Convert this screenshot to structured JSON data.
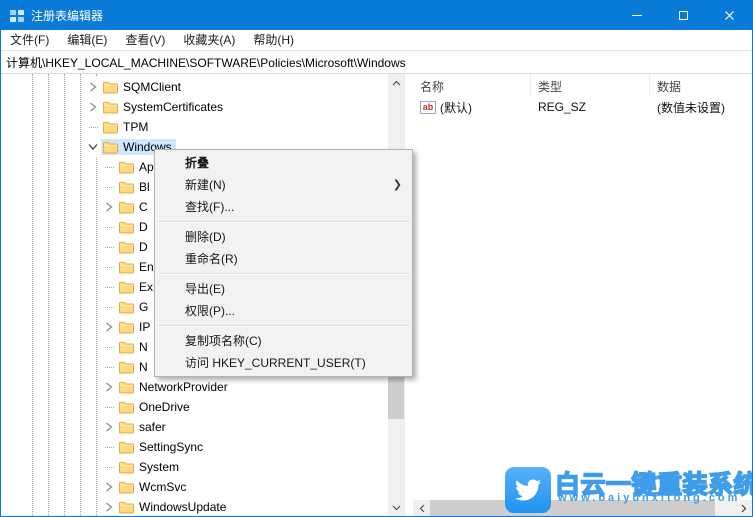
{
  "window": {
    "title": "注册表编辑器"
  },
  "icons": {
    "app": "registry-icon",
    "minimize": "minimize-icon",
    "maximize": "maximize-icon",
    "close": "close-icon",
    "string_value": "ab-string-value-icon",
    "watermark_logo": "twitter-bird-icon"
  },
  "menu_bar": {
    "items": [
      "文件(F)",
      "编辑(E)",
      "查看(V)",
      "收藏夹(A)",
      "帮助(H)"
    ]
  },
  "address_bar": {
    "value": "计算机\\HKEY_LOCAL_MACHINE\\SOFTWARE\\Policies\\Microsoft\\Windows"
  },
  "tree": {
    "items": [
      {
        "label": "SQMClient",
        "level": 0,
        "expander": "collapsed",
        "selected": false
      },
      {
        "label": "SystemCertificates",
        "level": 0,
        "expander": "collapsed",
        "selected": false
      },
      {
        "label": "TPM",
        "level": 0,
        "expander": "none",
        "selected": false
      },
      {
        "label": "Windows",
        "level": 0,
        "expander": "expanded",
        "selected": true
      },
      {
        "label": "Ap",
        "level": 1,
        "expander": "none",
        "selected": false
      },
      {
        "label": "Bl",
        "level": 1,
        "expander": "none",
        "selected": false
      },
      {
        "label": "C",
        "level": 1,
        "expander": "collapsed",
        "selected": false
      },
      {
        "label": "D",
        "level": 1,
        "expander": "none",
        "selected": false
      },
      {
        "label": "D",
        "level": 1,
        "expander": "none",
        "selected": false
      },
      {
        "label": "En",
        "level": 1,
        "expander": "none",
        "selected": false
      },
      {
        "label": "Ex",
        "level": 1,
        "expander": "none",
        "selected": false
      },
      {
        "label": "G",
        "level": 1,
        "expander": "none",
        "selected": false
      },
      {
        "label": "IP",
        "level": 1,
        "expander": "collapsed",
        "selected": false
      },
      {
        "label": "N",
        "level": 1,
        "expander": "none",
        "selected": false
      },
      {
        "label": "N",
        "level": 1,
        "expander": "none",
        "selected": false
      },
      {
        "label": "NetworkProvider",
        "level": 1,
        "expander": "collapsed",
        "selected": false
      },
      {
        "label": "OneDrive",
        "level": 1,
        "expander": "none",
        "selected": false
      },
      {
        "label": "safer",
        "level": 1,
        "expander": "collapsed",
        "selected": false
      },
      {
        "label": "SettingSync",
        "level": 1,
        "expander": "none",
        "selected": false
      },
      {
        "label": "System",
        "level": 1,
        "expander": "none",
        "selected": false
      },
      {
        "label": "WcmSvc",
        "level": 1,
        "expander": "collapsed",
        "selected": false
      },
      {
        "label": "WindowsUpdate",
        "level": 1,
        "expander": "collapsed",
        "selected": false
      }
    ]
  },
  "context_menu": {
    "items": [
      {
        "type": "item",
        "label": "折叠",
        "bold": true
      },
      {
        "type": "item",
        "label": "新建(N)",
        "submenu": true
      },
      {
        "type": "item",
        "label": "查找(F)..."
      },
      {
        "type": "separator"
      },
      {
        "type": "item",
        "label": "删除(D)"
      },
      {
        "type": "item",
        "label": "重命名(R)"
      },
      {
        "type": "separator"
      },
      {
        "type": "item",
        "label": "导出(E)"
      },
      {
        "type": "item",
        "label": "权限(P)..."
      },
      {
        "type": "separator"
      },
      {
        "type": "item",
        "label": "复制项名称(C)"
      },
      {
        "type": "item",
        "label": "访问 HKEY_CURRENT_USER(T)"
      }
    ]
  },
  "list": {
    "columns": [
      "名称",
      "类型",
      "数据"
    ],
    "rows": [
      {
        "icon": "ab",
        "name": "(默认)",
        "type": "REG_SZ",
        "data": "(数值未设置)"
      }
    ]
  },
  "watermark": {
    "title": "白云一键重装系统",
    "url": "www.baiyunxitong.com"
  },
  "colors": {
    "titlebar": "#0a7ad8",
    "selection": "#cce8ff",
    "menu_bg": "#f2f2f2",
    "watermark_blue": "#3f9ce8"
  }
}
